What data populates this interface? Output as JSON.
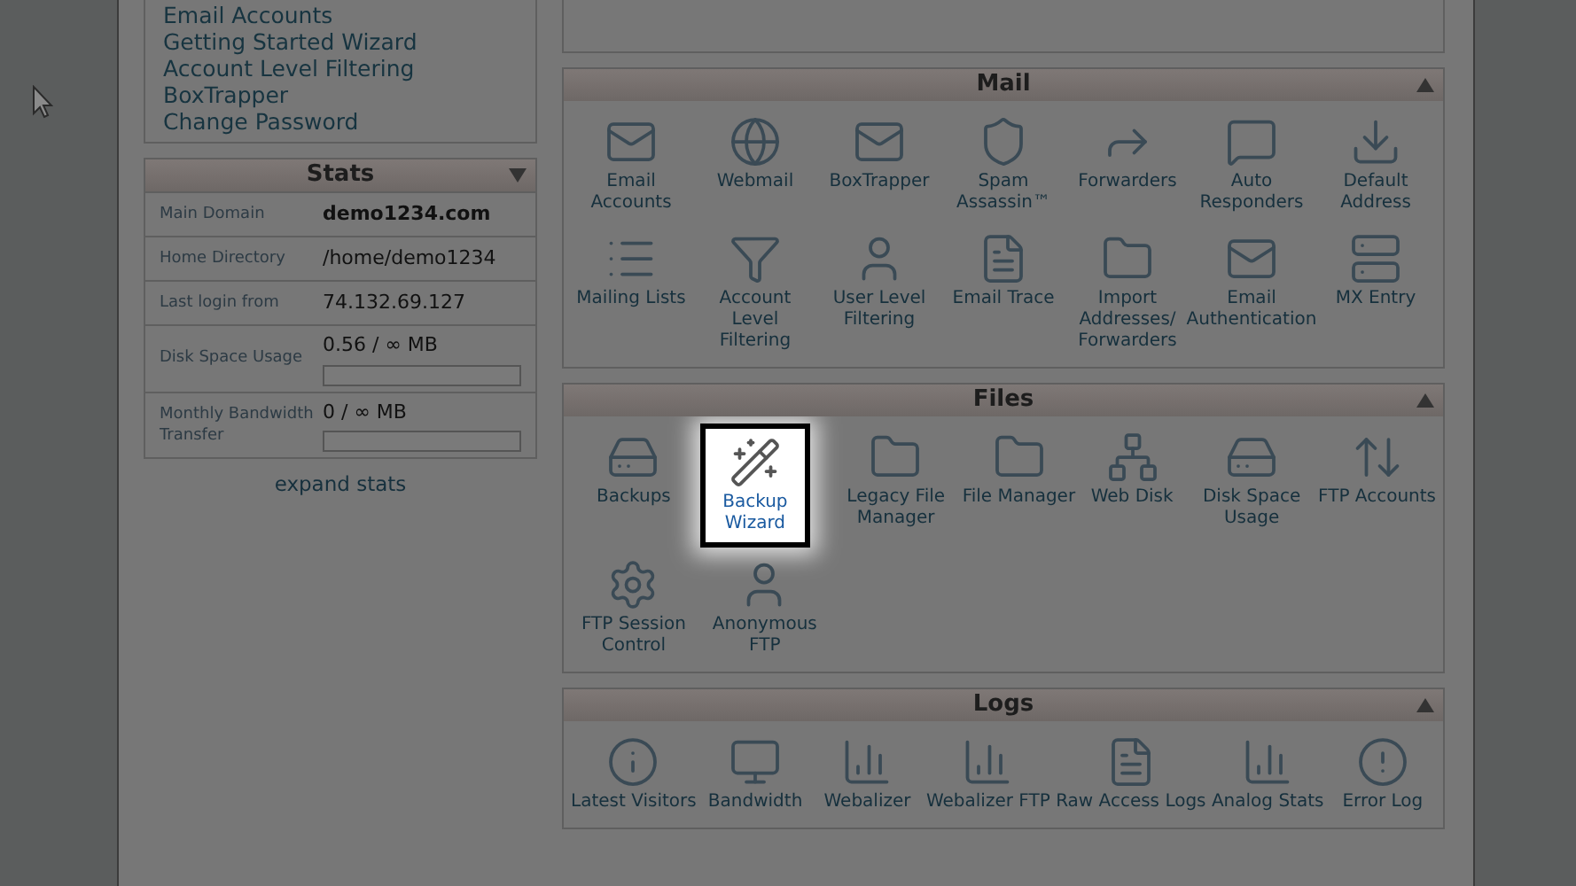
{
  "sidebar_links": [
    "Email Accounts",
    "Getting Started Wizard",
    "Account Level Filtering",
    "BoxTrapper",
    "Change Password"
  ],
  "stats": {
    "title": "Stats",
    "rows": [
      {
        "label": "Main Domain",
        "value": "demo1234.com",
        "kind": "bold"
      },
      {
        "label": "Home Directory",
        "value": "/home/demo1234",
        "kind": "text"
      },
      {
        "label": "Last login from",
        "value": "74.132.69.127",
        "kind": "text"
      },
      {
        "label": "Disk Space Usage",
        "value": "0.56 / ∞ MB",
        "kind": "meter"
      },
      {
        "label": "Monthly Bandwidth Transfer",
        "value": "0 / ∞ MB",
        "kind": "meter"
      }
    ]
  },
  "expand_stats": "expand stats",
  "sections": [
    {
      "title": "Mail",
      "items": [
        {
          "label": "Email Accounts",
          "kind": "mail",
          "selected": false
        },
        {
          "label": "Webmail",
          "kind": "globe",
          "selected": false
        },
        {
          "label": "BoxTrapper",
          "kind": "mail",
          "selected": false
        },
        {
          "label": "Spam Assassin™",
          "kind": "shield",
          "selected": false
        },
        {
          "label": "Forwarders",
          "kind": "forward",
          "selected": false
        },
        {
          "label": "Auto Responders",
          "kind": "chat",
          "selected": false
        },
        {
          "label": "Default Address",
          "kind": "download",
          "selected": false
        },
        {
          "label": "Mailing Lists",
          "kind": "list",
          "selected": false
        },
        {
          "label": "Account Level Filtering",
          "kind": "filter",
          "selected": false
        },
        {
          "label": "User Level Filtering",
          "kind": "user",
          "selected": false
        },
        {
          "label": "Email Trace",
          "kind": "doc",
          "selected": false
        },
        {
          "label": "Import Addresses/ Forwarders",
          "kind": "folder",
          "selected": false
        },
        {
          "label": "Email Authentication",
          "kind": "mail",
          "selected": false
        },
        {
          "label": "MX Entry",
          "kind": "server",
          "selected": false
        }
      ]
    },
    {
      "title": "Files",
      "items": [
        {
          "label": "Backups",
          "kind": "disk",
          "selected": false
        },
        {
          "label": "Backup Wizard",
          "kind": "wand",
          "selected": true
        },
        {
          "label": "Legacy File Manager",
          "kind": "folder",
          "selected": false
        },
        {
          "label": "File Manager",
          "kind": "folder",
          "selected": false
        },
        {
          "label": "Web Disk",
          "kind": "network",
          "selected": false
        },
        {
          "label": "Disk Space Usage",
          "kind": "disk",
          "selected": false
        },
        {
          "label": "FTP Accounts",
          "kind": "transfer",
          "selected": false
        },
        {
          "label": "FTP Session Control",
          "kind": "gear",
          "selected": false
        },
        {
          "label": "Anonymous FTP",
          "kind": "user",
          "selected": false
        }
      ]
    },
    {
      "title": "Logs",
      "items": [
        {
          "label": "Latest Visitors",
          "kind": "info",
          "selected": false
        },
        {
          "label": "Bandwidth",
          "kind": "monitor",
          "selected": false
        },
        {
          "label": "Webalizer",
          "kind": "chart",
          "selected": false
        },
        {
          "label": "Webalizer FTP",
          "kind": "chart",
          "selected": false
        },
        {
          "label": "Raw Access Logs",
          "kind": "doc",
          "selected": false
        },
        {
          "label": "Analog Stats",
          "kind": "chart",
          "selected": false
        },
        {
          "label": "Error Log",
          "kind": "alert",
          "selected": false
        }
      ]
    }
  ]
}
